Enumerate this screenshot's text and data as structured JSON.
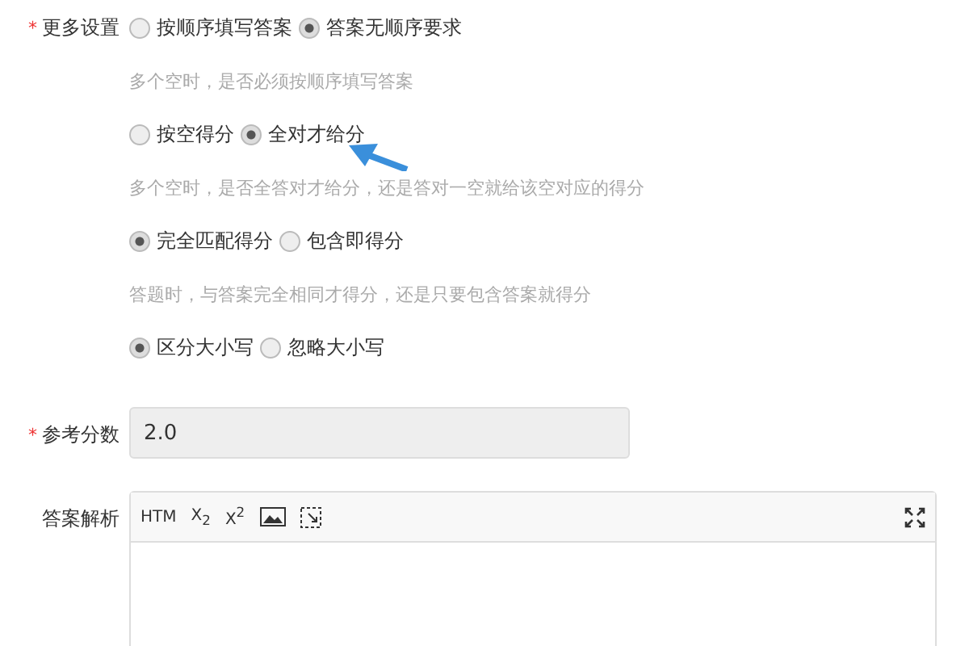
{
  "more_settings": {
    "label": "更多设置",
    "required_mark": "*",
    "groups": [
      {
        "options": [
          {
            "label": "按顺序填写答案",
            "selected": false
          },
          {
            "label": "答案无顺序要求",
            "selected": true
          }
        ],
        "hint": "多个空时，是否必须按顺序填写答案"
      },
      {
        "options": [
          {
            "label": "按空得分",
            "selected": false
          },
          {
            "label": "全对才给分",
            "selected": true
          }
        ],
        "hint": "多个空时，是否全答对才给分，还是答对一空就给该空对应的得分"
      },
      {
        "options": [
          {
            "label": "完全匹配得分",
            "selected": true
          },
          {
            "label": "包含即得分",
            "selected": false
          }
        ],
        "hint": "答题时，与答案完全相同才得分，还是只要包含答案就得分"
      },
      {
        "options": [
          {
            "label": "区分大小写",
            "selected": true
          },
          {
            "label": "忽略大小写",
            "selected": false
          }
        ]
      }
    ]
  },
  "score": {
    "label": "参考分数",
    "required_mark": "*",
    "value": "2.0"
  },
  "analysis": {
    "label": "答案解析",
    "toolbar": [
      {
        "kind": "text",
        "text": "HTM"
      },
      {
        "kind": "text",
        "text": "X$_{2}$"
      },
      {
        "kind": "text",
        "text": "X$^{2}$"
      },
      {
        "kind": "image"
      },
      {
        "kind": "select"
      }
    ]
  }
}
